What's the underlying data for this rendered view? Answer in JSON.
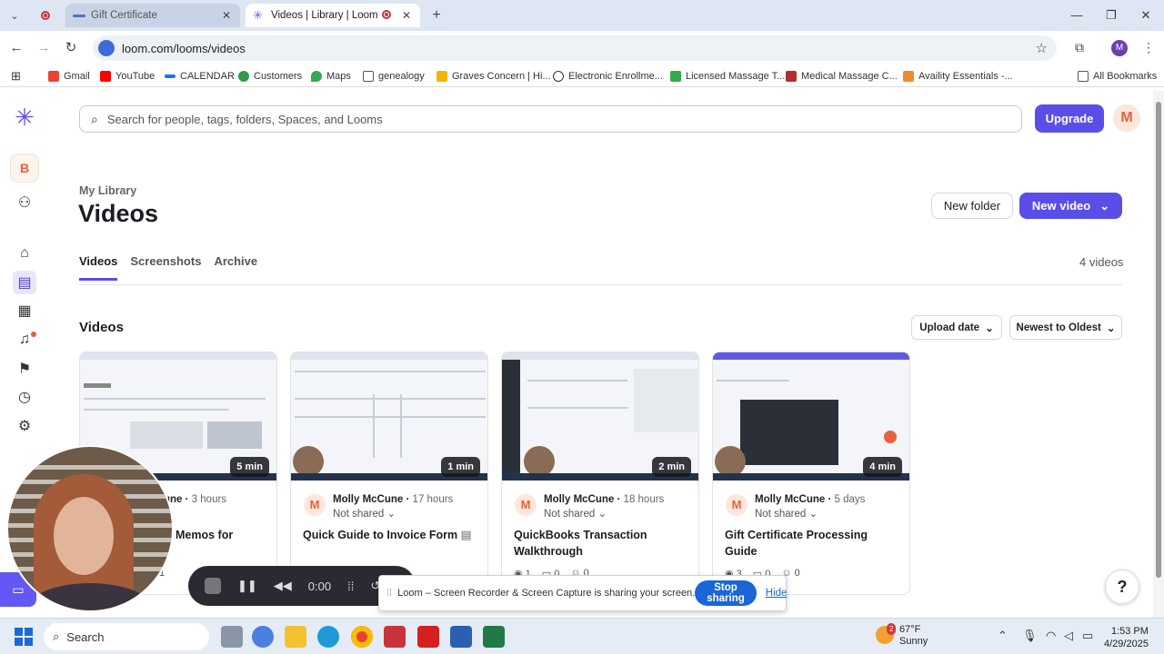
{
  "browser": {
    "tabs": [
      {
        "title": "Gift Certificate",
        "active": false
      },
      {
        "title": "Videos | Library | Loom",
        "active": true
      }
    ],
    "url": "loom.com/looms/videos",
    "bookmarks": [
      {
        "label": "Gmail",
        "color": "#ea4335"
      },
      {
        "label": "YouTube",
        "color": "#ff0000"
      },
      {
        "label": "CALENDAR",
        "color": "#1a73e8"
      },
      {
        "label": "Customers",
        "color": "#2e9c4a"
      },
      {
        "label": "Maps",
        "color": "#34a853"
      },
      {
        "label": "genealogy",
        "color": "#555555"
      },
      {
        "label": "Graves Concern | Hi...",
        "color": "#f2b600"
      },
      {
        "label": "Electronic Enrollme...",
        "color": "#333333"
      },
      {
        "label": "Licensed Massage T...",
        "color": "#2fae4a"
      },
      {
        "label": "Medical Massage C...",
        "color": "#b22d2d"
      },
      {
        "label": "Availity Essentials -...",
        "color": "#f08a2c"
      }
    ],
    "all_bookmarks": "All Bookmarks",
    "profile_initial": "M"
  },
  "loom": {
    "workspace_initial": "B",
    "search_placeholder": "Search for people, tags, folders, Spaces, and Looms",
    "upgrade_label": "Upgrade",
    "user_initial": "M",
    "breadcrumb": "My Library",
    "page_title": "Videos",
    "new_folder_label": "New folder",
    "new_video_label": "New video",
    "tabs": [
      "Videos",
      "Screenshots",
      "Archive"
    ],
    "video_count": "4 videos",
    "section_title": "Videos",
    "sort_field": "Upload date",
    "sort_order": "Newest to Oldest",
    "videos": [
      {
        "duration": "5 min",
        "author": "Molly McCune",
        "author_visible": "une",
        "age": "3 hours",
        "share": "Not shared",
        "title": "Memos for",
        "views": "1",
        "comments": "",
        "reactions": ""
      },
      {
        "duration": "1 min",
        "author": "Molly McCune",
        "age": "17 hours",
        "share": "Not shared",
        "title": "Quick Guide to Invoice Form",
        "views": "",
        "comments": "",
        "reactions": ""
      },
      {
        "duration": "2 min",
        "author": "Molly McCune",
        "age": "18 hours",
        "share": "Not shared",
        "title": "QuickBooks Transaction Walkthrough",
        "views": "1",
        "comments": "0",
        "reactions": "0"
      },
      {
        "duration": "4 min",
        "author": "Molly McCune",
        "age": "5 days",
        "share": "Not shared",
        "title": "Gift Certificate Processing Guide",
        "views": "3",
        "comments": "0",
        "reactions": "0"
      }
    ],
    "accent_color": "#5a4ee8"
  },
  "recorder": {
    "timer": "0:00",
    "share_message": "Loom – Screen Recorder & Screen Capture is sharing your screen.",
    "stop_sharing_label": "Stop sharing",
    "hide_label": "Hide"
  },
  "taskbar": {
    "search_label": "Search",
    "weather_temp": "67°F",
    "weather_desc": "Sunny",
    "weather_badge": "2",
    "time": "1:53 PM",
    "date": "4/29/2025"
  }
}
